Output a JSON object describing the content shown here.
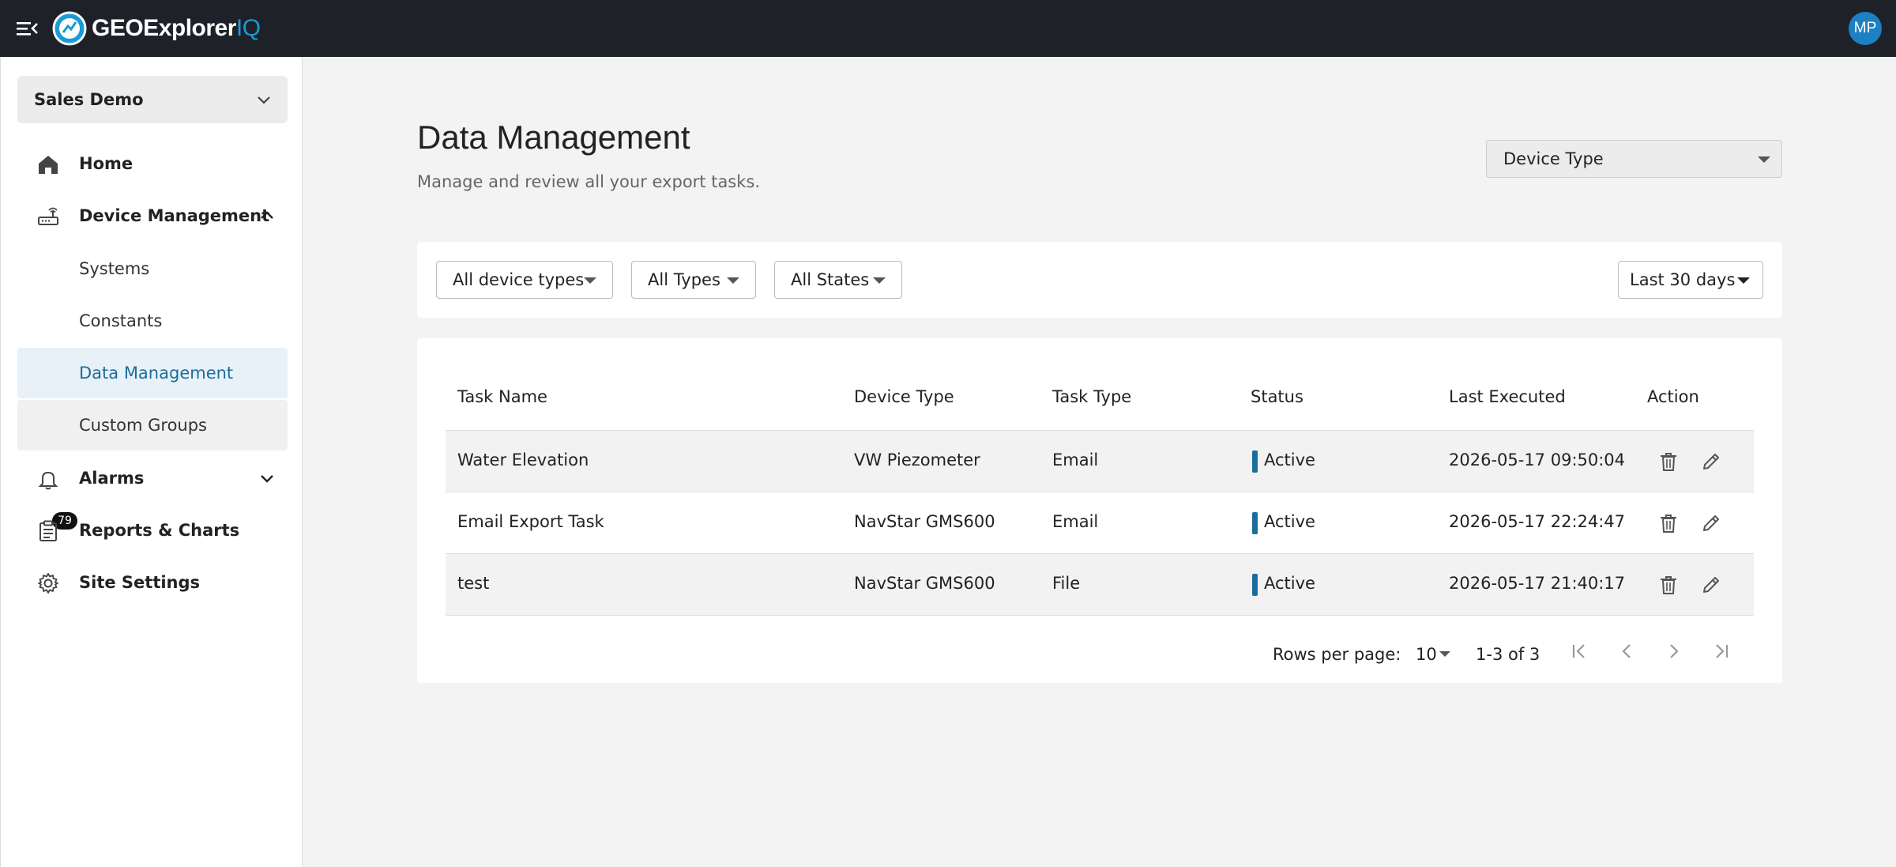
{
  "app": {
    "logo_text": "GEOExplorer",
    "logo_suffix": "IQ",
    "user_initials": "MP"
  },
  "sidebar": {
    "org": "Sales Demo",
    "items": {
      "home": "Home",
      "device_management": "Device Management",
      "systems": "Systems",
      "constants": "Constants",
      "data_management": "Data Management",
      "custom_groups": "Custom Groups",
      "alarms": "Alarms",
      "alarms_badge": "79",
      "reports": "Reports & Charts",
      "site_settings": "Site Settings"
    }
  },
  "main": {
    "title": "Data Management",
    "subtitle": "Manage and review all your export tasks.",
    "device_type_select": "Device Type",
    "filters": {
      "device_types": "All device types",
      "types": "All Types",
      "states": "All States",
      "range": "Last 30 days"
    },
    "table": {
      "headers": [
        "Task Name",
        "Device Type",
        "Task Type",
        "Status",
        "Last Executed",
        "Action"
      ],
      "rows": [
        {
          "task_name": "Water Elevation",
          "device_type": "VW Piezometer",
          "task_type": "Email",
          "status": "Active",
          "last_executed": "2026-05-17 09:50:04"
        },
        {
          "task_name": "Email Export Task",
          "device_type": "NavStar GMS600",
          "task_type": "Email",
          "status": "Active",
          "last_executed": "2026-05-17 22:24:47"
        },
        {
          "task_name": "test",
          "device_type": "NavStar GMS600",
          "task_type": "File",
          "status": "Active",
          "last_executed": "2026-05-17 21:40:17"
        }
      ]
    },
    "pagination": {
      "rows_per_page_label": "Rows per page:",
      "rows_per_page": "10",
      "range": "1-3 of 3"
    }
  },
  "colors": {
    "topbar": "#1e2228",
    "accent": "#1a6d9c",
    "avatar": "#1c80c2",
    "logo_iq": "#1a9ad6"
  }
}
